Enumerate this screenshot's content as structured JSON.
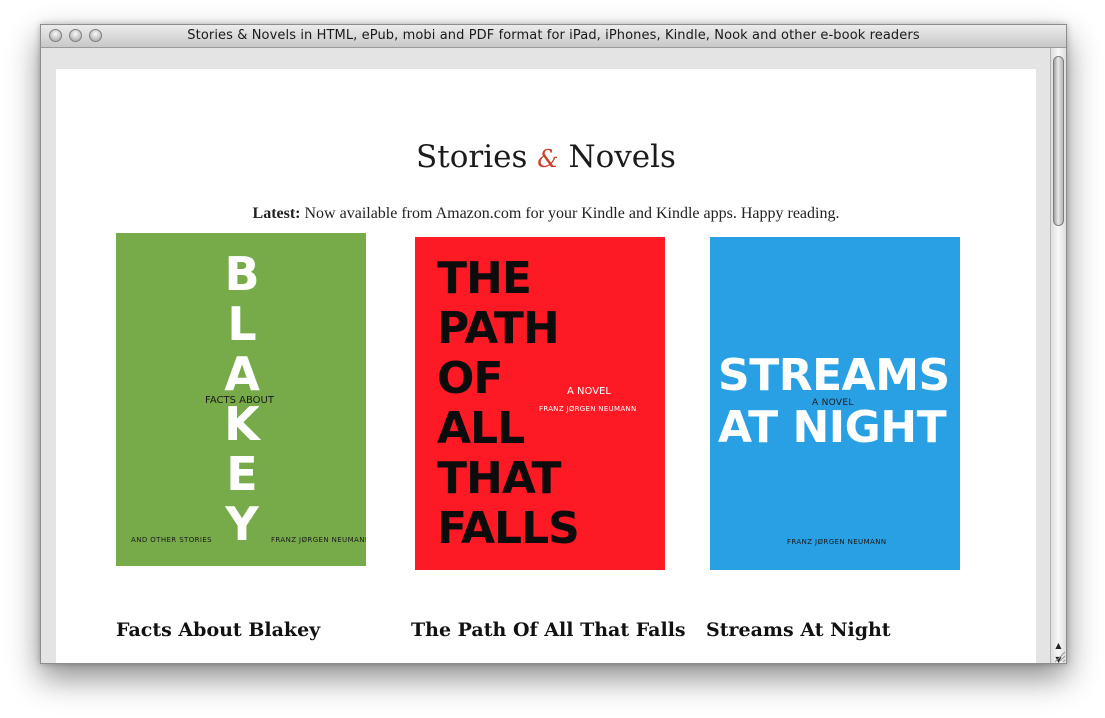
{
  "window": {
    "title": "Stories & Novels in HTML, ePub, mobi and PDF format for iPad, iPhones, Kindle, Nook and other e-book readers"
  },
  "site": {
    "title_part1": "Stories",
    "title_amp": "&",
    "title_part2": "Novels",
    "latest_label": "Latest:",
    "latest_text": "Now available from Amazon.com for your Kindle and Kindle apps. Happy reading."
  },
  "books": [
    {
      "title": "Facts About Blakey",
      "cover_color": "#77ab4a",
      "cover": {
        "letters": [
          "B",
          "L",
          "A",
          "K",
          "E",
          "Y"
        ],
        "overlay": "FACTS ABOUT",
        "footer_left": "AND OTHER STORIES",
        "footer_right": "FRANZ JØRGEN NEUMANN"
      }
    },
    {
      "title": "The Path Of All That Falls",
      "cover_color": "#fe1a25",
      "cover": {
        "lines": [
          "THE",
          "PATH",
          "OF",
          "ALL",
          "THAT",
          "FALLS"
        ],
        "subtitle": "A NOVEL",
        "author": "FRANZ JØRGEN NEUMANN"
      }
    },
    {
      "title": "Streams At Night",
      "cover_color": "#29a0e4",
      "cover": {
        "line1": "STREAMS",
        "line2": "AT NIGHT",
        "subtitle": "A NOVEL",
        "author": "FRANZ JØRGEN NEUMANN"
      }
    }
  ],
  "scrollbar": {
    "up_icon": "▲",
    "down_icon": "▼"
  }
}
